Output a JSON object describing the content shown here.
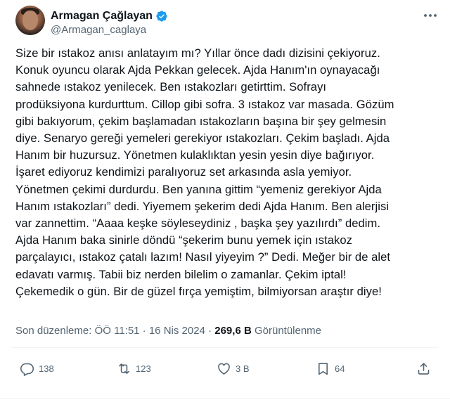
{
  "author": {
    "display_name": "Armagan Çağlayan",
    "handle": "@Armagan_caglaya"
  },
  "icons": {
    "verified": "verified-badge-icon",
    "more": "more-options-icon",
    "reply": "reply-icon",
    "repost": "repost-icon",
    "like": "like-icon",
    "bookmark": "bookmark-icon",
    "share": "share-icon"
  },
  "colors": {
    "verified": "#1d9bf0",
    "muted": "#536471",
    "text": "#0f1419"
  },
  "tweet": {
    "text": "Size bir ıstakoz anısı anlatayım mı? Yıllar önce dadı dizisini çekiyoruz.\nKonuk oyuncu olarak Ajda Pekkan gelecek. Ajda Hanım'ın oynayacağı\nsahnede ıstakoz yenilecek. Ben ıstakozları getirttim. Sofrayı\nprodüksiyona kurdurttum. Cillop gibi sofra. 3 ıstakoz var masada. Gözüm\ngibi bakıyorum, çekim başlamadan ıstakozların başına bir şey gelmesin\ndiye. Senaryo gereği yemeleri gerekiyor ıstakozları. Çekim başladı. Ajda\nHanım bir huzursuz. Yönetmen kulaklıktan yesin yesin diye bağırıyor.\nİşaret ediyoruz kendimizi paralıyoruz set arkasında asla yemiyor.\nYönetmen çekimi durdurdu. Ben yanına gittim “yemeniz gerekiyor Ajda\nHanım ıstakozları” dedi. Yiyemem şekerim dedi Ajda Hanım. Ben alerjisi\nvar zannettim. “Aaaa keşke söyleseydiniz , başka şey yazılırdı” dedim.\nAjda Hanım baka sinirle döndü “şekerim bunu yemek için ıstakoz\nparçalayıcı, ıstakoz çatalı lazım! Nasıl yiyeyim ?” Dedi. Meğer bir de alet\nedavatı varmış. Tabii biz nerden bilelim o zamanlar. Çekim iptal!\nÇekemedik o gün. Bir de güzel fırça yemiştim, bilmiyorsan araştır diye!",
    "edited_label": "Son düzenleme: ÖÖ 11:51",
    "separator": " · ",
    "date": "16 Nis 2024",
    "views_count": "269,6 B",
    "views_label": "Görüntülenme"
  },
  "actions": {
    "replies": "138",
    "reposts": "123",
    "likes": "3 B",
    "bookmarks": "64"
  }
}
